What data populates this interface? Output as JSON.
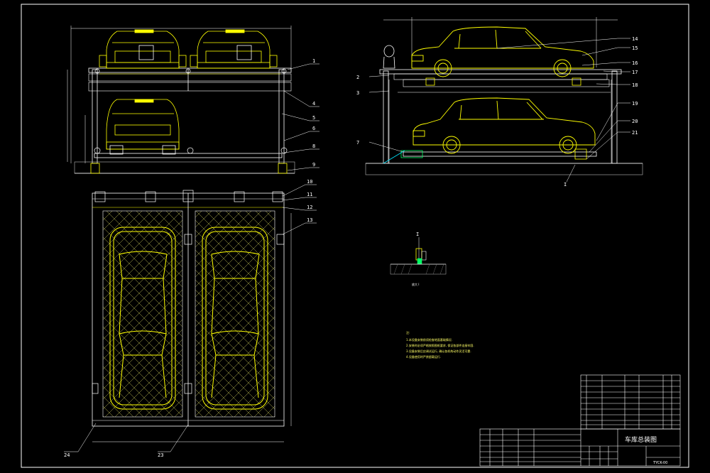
{
  "drawing": {
    "background": "#000000",
    "colors": {
      "frame": "#ffffff",
      "car": "#ffff00",
      "steel": "#ffffff",
      "ground": "#bbbbbb",
      "green": "#00ff66",
      "cyan": "#00e5ff",
      "hatch": "#cccc66"
    }
  },
  "front_view": {
    "callouts": [
      "1",
      "4",
      "5",
      "6",
      "8",
      "9"
    ]
  },
  "plan_view": {
    "callouts": [
      "10",
      "11",
      "12",
      "13"
    ],
    "bottom_callouts": [
      "24",
      "23"
    ]
  },
  "side_view": {
    "callouts_right": [
      "14",
      "15",
      "16",
      "17",
      "18",
      "19",
      "20",
      "21"
    ],
    "callouts_left": [
      "2",
      "3",
      "7"
    ],
    "section_mark": "I"
  },
  "detail": {
    "mark": "I",
    "caption": "放大 I"
  },
  "notes": {
    "heading": "注:",
    "lines": [
      "1.本设备安装前须检查地面基础情况.",
      "2.安装时必须严格按照图纸要求, 保证各部件连接牢固.",
      "3.设备安装后应调试运行, 确认各机构动作灵活可靠.",
      "4.设备使用时严禁超载运行."
    ]
  },
  "title_block": {
    "title": "车库总装图",
    "code": "TYCK-00"
  }
}
